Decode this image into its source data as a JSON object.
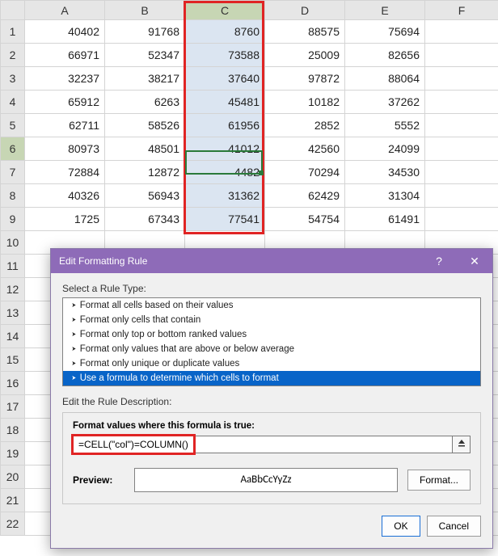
{
  "spreadsheet": {
    "columns": [
      "A",
      "B",
      "C",
      "D",
      "E",
      "F"
    ],
    "rows": [
      {
        "n": "1",
        "cells": [
          "40402",
          "91768",
          "8760",
          "88575",
          "75694",
          ""
        ]
      },
      {
        "n": "2",
        "cells": [
          "66971",
          "52347",
          "73588",
          "25009",
          "82656",
          ""
        ]
      },
      {
        "n": "3",
        "cells": [
          "32237",
          "38217",
          "37640",
          "97872",
          "88064",
          ""
        ]
      },
      {
        "n": "4",
        "cells": [
          "65912",
          "6263",
          "45481",
          "10182",
          "37262",
          ""
        ]
      },
      {
        "n": "5",
        "cells": [
          "62711",
          "58526",
          "61956",
          "2852",
          "5552",
          ""
        ]
      },
      {
        "n": "6",
        "cells": [
          "80973",
          "48501",
          "41012",
          "42560",
          "24099",
          ""
        ]
      },
      {
        "n": "7",
        "cells": [
          "72884",
          "12872",
          "4482",
          "70294",
          "34530",
          ""
        ]
      },
      {
        "n": "8",
        "cells": [
          "40326",
          "56943",
          "31362",
          "62429",
          "31304",
          ""
        ]
      },
      {
        "n": "9",
        "cells": [
          "1725",
          "67343",
          "77541",
          "54754",
          "61491",
          ""
        ]
      },
      {
        "n": "10",
        "cells": [
          "",
          "",
          "",
          "",
          "",
          ""
        ]
      },
      {
        "n": "11",
        "cells": [
          "",
          "",
          "",
          "",
          "",
          ""
        ]
      },
      {
        "n": "12",
        "cells": [
          "",
          "",
          "",
          "",
          "",
          ""
        ]
      },
      {
        "n": "13",
        "cells": [
          "",
          "",
          "",
          "",
          "",
          ""
        ]
      },
      {
        "n": "14",
        "cells": [
          "",
          "",
          "",
          "",
          "",
          ""
        ]
      },
      {
        "n": "15",
        "cells": [
          "",
          "",
          "",
          "",
          "",
          ""
        ]
      },
      {
        "n": "16",
        "cells": [
          "",
          "",
          "",
          "",
          "",
          ""
        ]
      },
      {
        "n": "17",
        "cells": [
          "",
          "",
          "",
          "",
          "",
          ""
        ]
      },
      {
        "n": "18",
        "cells": [
          "",
          "",
          "",
          "",
          "",
          ""
        ]
      },
      {
        "n": "19",
        "cells": [
          "",
          "",
          "",
          "",
          "",
          ""
        ]
      },
      {
        "n": "20",
        "cells": [
          "",
          "",
          "",
          "",
          "",
          ""
        ]
      },
      {
        "n": "21",
        "cells": [
          "",
          "",
          "",
          "",
          "",
          ""
        ]
      },
      {
        "n": "22",
        "cells": [
          "",
          "",
          "",
          "",
          "",
          ""
        ]
      }
    ],
    "highlighted_column_index": 2,
    "active_row_index": 5
  },
  "dialog": {
    "title": "Edit Formatting Rule",
    "help": "?",
    "close": "✕",
    "select_label": "Select a Rule Type:",
    "rules": [
      "Format all cells based on their values",
      "Format only cells that contain",
      "Format only top or bottom ranked values",
      "Format only values that are above or below average",
      "Format only unique or duplicate values",
      "Use a formula to determine which cells to format"
    ],
    "selected_rule_index": 5,
    "edit_label": "Edit the Rule Description:",
    "formula_label": "Format values where this formula is true:",
    "formula_value": "=CELL(\"col\")=COLUMN()",
    "preview_label": "Preview:",
    "preview_text": "AaBbCcYyZz",
    "format_btn": "Format...",
    "ok": "OK",
    "cancel": "Cancel"
  }
}
